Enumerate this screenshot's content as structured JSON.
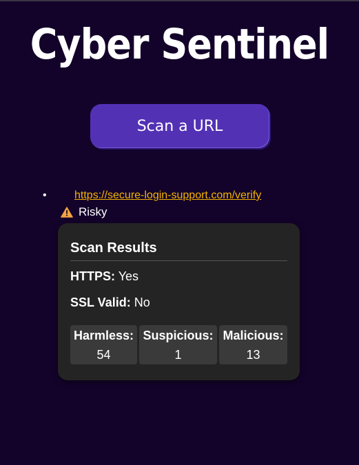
{
  "app": {
    "title": "Cyber Sentinel"
  },
  "scan_button": {
    "label": "Scan a URL"
  },
  "results": [
    {
      "url": "https://secure-login-support.com/verify",
      "status_icon": "warning-icon",
      "status": "Risky"
    }
  ],
  "card": {
    "title": "Scan Results",
    "https_label": "HTTPS:",
    "https_value": "Yes",
    "ssl_label": "SSL Valid:",
    "ssl_value": "No",
    "stats": [
      {
        "label": "Harmless:",
        "value": "54"
      },
      {
        "label": "Suspicious:",
        "value": "1"
      },
      {
        "label": "Malicious:",
        "value": "13"
      }
    ]
  },
  "colors": {
    "background": "#13032a",
    "accent": "#5331b5",
    "link": "#f5b400",
    "card": "#242424",
    "warning": "#f4a340"
  }
}
